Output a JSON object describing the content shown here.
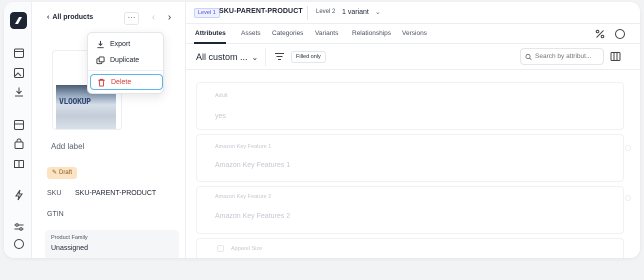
{
  "rail": {
    "icons": [
      "home-icon",
      "calendar-icon",
      "image-icon",
      "download-icon",
      "layout-icon",
      "bag-icon",
      "book-icon",
      "bolt-icon",
      "sliders-icon",
      "chat-icon"
    ]
  },
  "left_panel": {
    "back_label": "All products",
    "more_label": "···",
    "prev_label": "‹",
    "next_label": "›",
    "image_text": "VLOOKUP",
    "add_label": "Add label",
    "draft_badge": "Draft",
    "sku_label": "SKU",
    "sku_value": "SKU-PARENT-PRODUCT",
    "gtin_label": "GTIN",
    "family_label": "Product Family",
    "family_value": "Unassigned"
  },
  "menu": {
    "items": [
      {
        "label": "Export",
        "icon": "download-icon"
      },
      {
        "label": "Duplicate",
        "icon": "copy-icon"
      },
      {
        "label": "Delete",
        "icon": "trash-icon",
        "color": "#d03a3a"
      }
    ]
  },
  "topbar": {
    "level1": "Level 1",
    "parent_sku": "SKU-PARENT-PRODUCT",
    "level2": "Level 2",
    "variants": "1 variant"
  },
  "tabs": {
    "items": [
      "Attributes",
      "Assets",
      "Categories",
      "Variants",
      "Relationships",
      "Versions"
    ],
    "active": "Attributes"
  },
  "toolbar": {
    "view_select": "All custom ...",
    "filled_only": "Filled only",
    "search_placeholder": "Search by attribut..."
  },
  "attributes": [
    {
      "label": "Adult",
      "value": "yes"
    },
    {
      "label": "Amazon Key Feature 1",
      "value": "Amazon Key Features 1"
    },
    {
      "label": "Amazon Key Feature 2",
      "value": "Amazon Key Features 2"
    },
    {
      "label": "Apparel Size",
      "value": ""
    }
  ],
  "colors": {
    "accent": "#4f46e5",
    "delete": "#d03a3a",
    "draft_bg": "#fbe3c4",
    "focus_ring": "#5fb6e8"
  }
}
